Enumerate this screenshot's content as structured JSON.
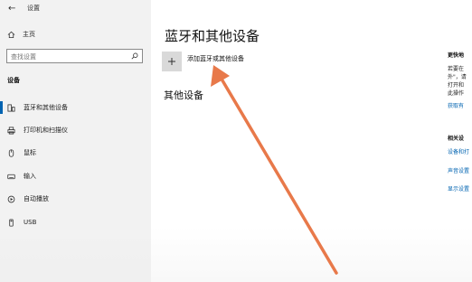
{
  "window": {
    "back_glyph": "←",
    "title": "设置"
  },
  "sidebar": {
    "home_label": "主页",
    "search": {
      "placeholder": "查找设置",
      "value": ""
    },
    "section_title": "设备",
    "items": [
      {
        "label": "蓝牙和其他设备",
        "icon": "bluetooth-devices-icon",
        "active": true
      },
      {
        "label": "打印机和扫描仪",
        "icon": "printer-icon",
        "active": false
      },
      {
        "label": "鼠标",
        "icon": "mouse-icon",
        "active": false
      },
      {
        "label": "输入",
        "icon": "keyboard-icon",
        "active": false
      },
      {
        "label": "自动播放",
        "icon": "autoplay-icon",
        "active": false
      },
      {
        "label": "USB",
        "icon": "usb-icon",
        "active": false
      }
    ]
  },
  "main": {
    "title": "蓝牙和其他设备",
    "add_device_label": "添加蓝牙或其他设备",
    "add_glyph": "+",
    "other_devices_title": "其他设备"
  },
  "right_pane": {
    "heading": "更快地",
    "lines": [
      "若要在",
      "外\"，请",
      "打开和",
      "此操作"
    ],
    "link1": "获取有",
    "related_heading": "相关设",
    "related_links": [
      "设备和打",
      "声音设置",
      "显示设置"
    ]
  },
  "annotation": {
    "arrow_color": "#e8794a"
  },
  "colors": {
    "accent": "#0063b1",
    "sidebar_bg": "#f2f2f2"
  }
}
